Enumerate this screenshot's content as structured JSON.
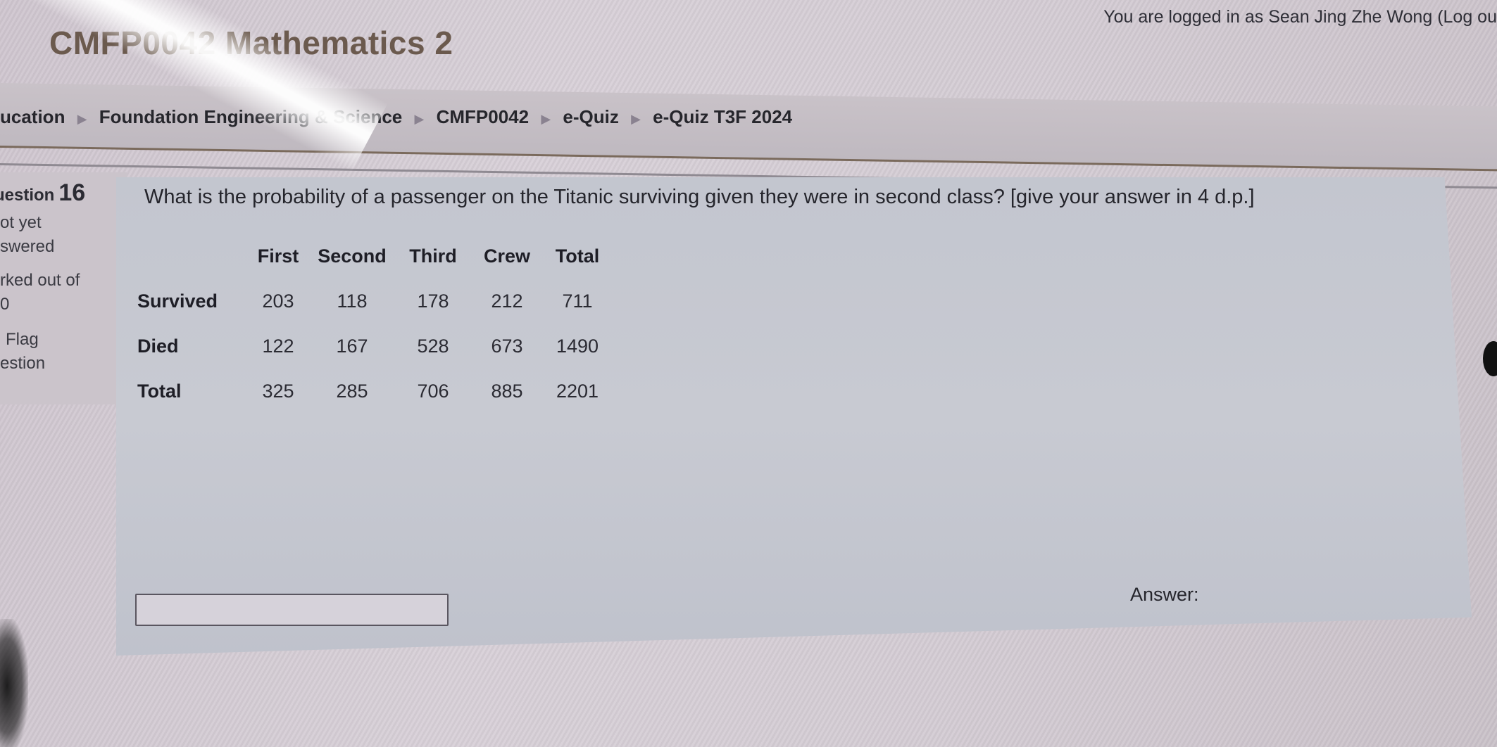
{
  "header": {
    "site_title": "CMFP0042 Mathematics 2",
    "login_info": {
      "prefix": "You are logged in as",
      "user_name": "Sean Jing Zhe Wong",
      "logout_label": "(Log ou"
    }
  },
  "breadcrumb": {
    "items": [
      {
        "label": "ucation"
      },
      {
        "label": "Foundation Engineering & Science"
      },
      {
        "label": "CMFP0042"
      },
      {
        "label": "e-Quiz"
      },
      {
        "label": "e-Quiz T3F 2024"
      }
    ],
    "separator": "▶"
  },
  "question_info": {
    "label": "uestion",
    "number": "16",
    "state_line1": "ot yet",
    "state_line2": "swered",
    "grade_line1": "rked out of",
    "grade_line2": "0",
    "flag_line1": "Flag",
    "flag_line2": "estion"
  },
  "question": {
    "text": "What is the probability of a passenger on the Titanic surviving given they were in second class? [give your answer in 4 d.p.]",
    "table": {
      "columns": [
        "First",
        "Second",
        "Third",
        "Crew",
        "Total"
      ],
      "rows": [
        {
          "label": "Survived",
          "values": [
            "203",
            "118",
            "178",
            "212",
            "711"
          ]
        },
        {
          "label": "Died",
          "values": [
            "122",
            "167",
            "528",
            "673",
            "1490"
          ]
        },
        {
          "label": "Total",
          "values": [
            "325",
            "285",
            "706",
            "885",
            "2201"
          ]
        }
      ]
    },
    "answer_label": "Answer:",
    "answer_value": ""
  },
  "colors": {
    "title": "#6b5a4e",
    "text": "#25252c",
    "content_bg": "#c5c8d0",
    "info_bg": "#cbc4cb"
  }
}
